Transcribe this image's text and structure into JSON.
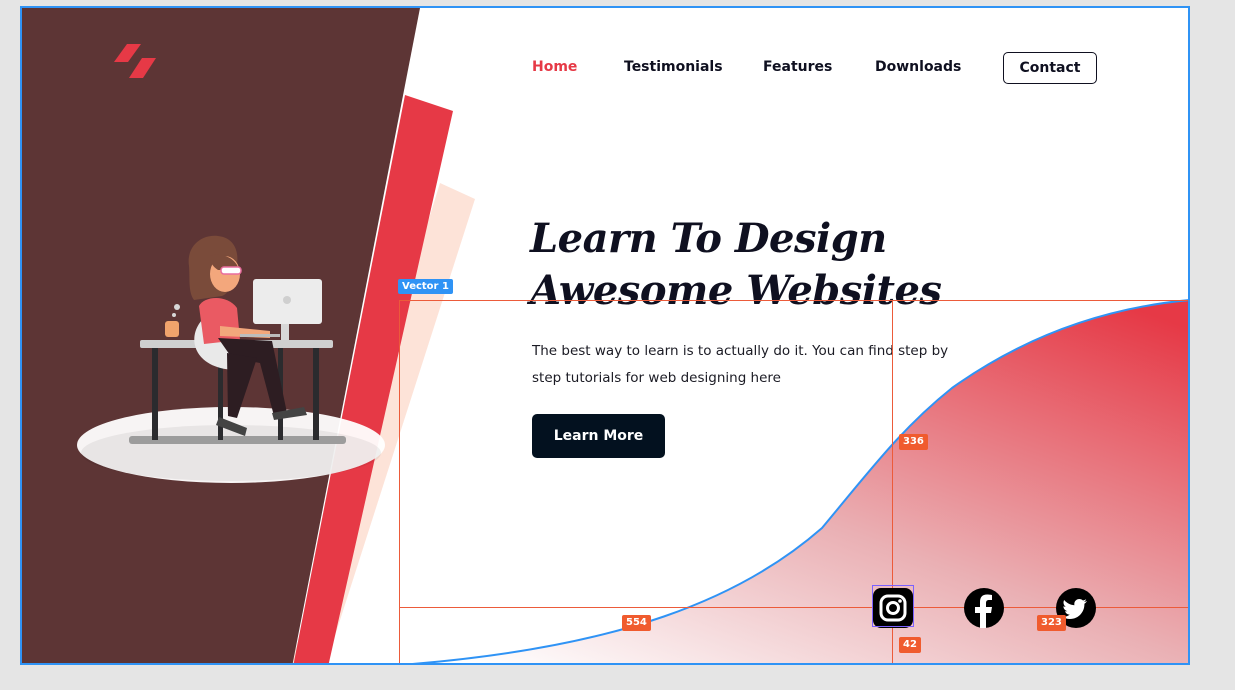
{
  "colors": {
    "accent": "#e63946",
    "brown_panel": "#5d3535",
    "peach": "#fde3d8",
    "dark_button": "#03111f",
    "selection_blue": "#2f93f5",
    "measure_red": "#f05b2e"
  },
  "logo": {
    "icon": "lightning-slashes-logo-icon"
  },
  "nav": {
    "items": [
      {
        "label": "Home",
        "active": true
      },
      {
        "label": "Testimonials",
        "active": false
      },
      {
        "label": "Features",
        "active": false
      },
      {
        "label": "Downloads",
        "active": false
      }
    ],
    "contact_label": "Contact"
  },
  "hero": {
    "title_line1": "Learn To Design",
    "title_line2": "Awesome Websites",
    "description": "The best way to learn is to actually do it. You can find step by step tutorials for web designing here",
    "cta_label": "Learn More"
  },
  "social": [
    {
      "icon": "instagram-icon"
    },
    {
      "icon": "facebook-icon"
    },
    {
      "icon": "twitter-icon"
    }
  ],
  "editor_overlay": {
    "layer_tag": "Vector 1",
    "measure_vertical": "336",
    "measure_horizontal_left": "554",
    "measure_small": "42",
    "measure_horizontal_right": "323"
  }
}
